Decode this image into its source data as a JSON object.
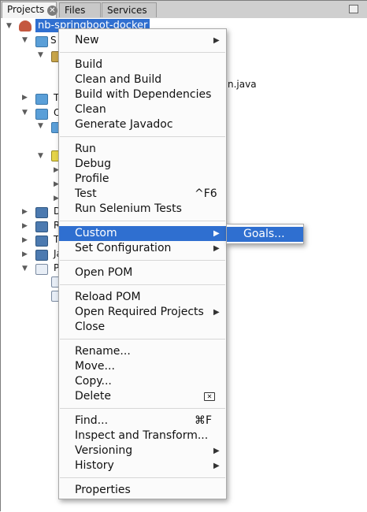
{
  "tabs": [
    {
      "label": "Projects"
    },
    {
      "label": "Files"
    },
    {
      "label": "Services"
    }
  ],
  "tree": {
    "root_label": "nb-springboot-docker",
    "visible_fragments": [
      "S",
      "T",
      "O",
      "D",
      "R",
      "T",
      "Ja",
      "P"
    ],
    "java_file_fragment": "n.java"
  },
  "context_menu": {
    "items": [
      {
        "label": "New",
        "submenu": true
      },
      {
        "label": "Build"
      },
      {
        "label": "Clean and Build"
      },
      {
        "label": "Build with Dependencies"
      },
      {
        "label": "Clean"
      },
      {
        "label": "Generate Javadoc"
      },
      {
        "label": "Run"
      },
      {
        "label": "Debug"
      },
      {
        "label": "Profile"
      },
      {
        "label": "Test",
        "shortcut": "^F6"
      },
      {
        "label": "Run Selenium Tests"
      },
      {
        "label": "Custom",
        "submenu": true,
        "highlighted": true
      },
      {
        "label": "Set Configuration",
        "submenu": true
      },
      {
        "label": "Open POM"
      },
      {
        "label": "Reload POM"
      },
      {
        "label": "Open Required Projects",
        "submenu": true
      },
      {
        "label": "Close"
      },
      {
        "label": "Rename..."
      },
      {
        "label": "Move..."
      },
      {
        "label": "Copy..."
      },
      {
        "label": "Delete",
        "icon": "delete-key-icon"
      },
      {
        "label": "Find...",
        "shortcut": "⌘F"
      },
      {
        "label": "Inspect and Transform..."
      },
      {
        "label": "Versioning",
        "submenu": true
      },
      {
        "label": "History",
        "submenu": true
      },
      {
        "label": "Properties"
      }
    ]
  },
  "custom_submenu": {
    "items": [
      {
        "label": "Goals..."
      }
    ]
  },
  "colors": {
    "selection": "#2f6fd0",
    "menu_bg": "#fbfbfb",
    "tab_bar": "#cfcfcf"
  }
}
